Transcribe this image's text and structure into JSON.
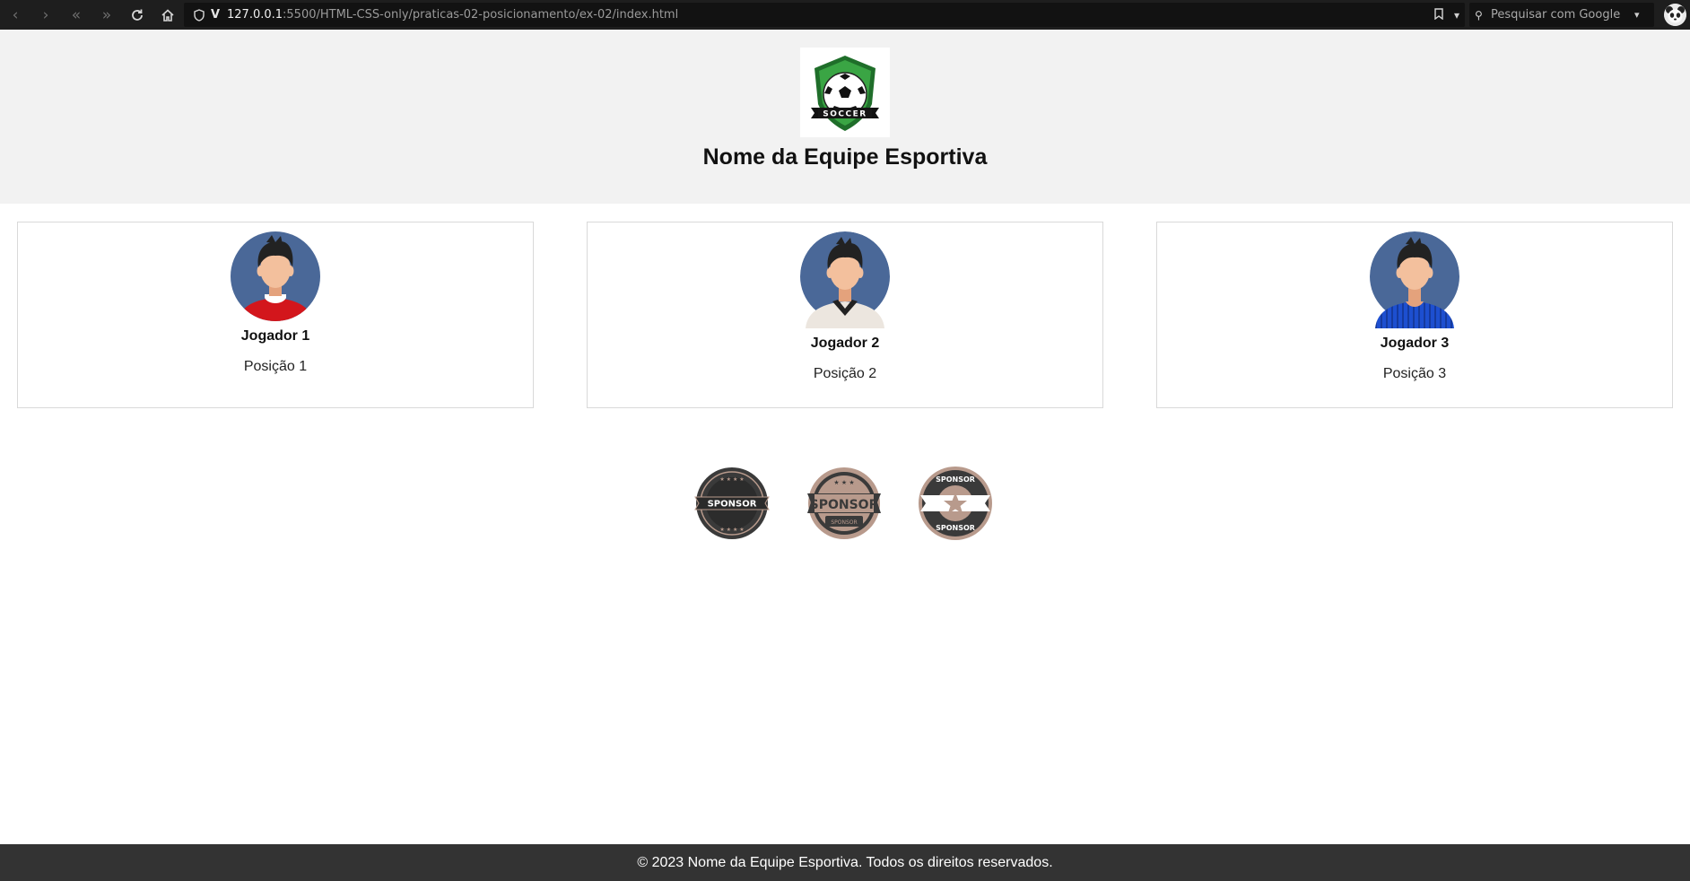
{
  "browser": {
    "url_host": "127.0.0.1",
    "url_rest": ":5500/HTML-CSS-only/praticas-02-posicionamento/ex-02/index.html",
    "search_placeholder": "Pesquisar com Google",
    "nav_icons": [
      "back-icon",
      "forward-icon",
      "rewind-icon",
      "fast-forward-icon",
      "reload-icon",
      "home-icon"
    ]
  },
  "header": {
    "logo_text": "SOCCER",
    "team_name": "Nome da Equipe Esportiva"
  },
  "players": [
    {
      "name": "Jogador 1",
      "position": "Posição 1",
      "shirt_color": "#d3161c"
    },
    {
      "name": "Jogador 2",
      "position": "Posição 2",
      "shirt_color": "#ece6df"
    },
    {
      "name": "Jogador 3",
      "position": "Posição 3",
      "shirt_color": "#1d4fd0"
    }
  ],
  "sponsors": [
    {
      "label": "SPONSOR"
    },
    {
      "label": "SPONSOR",
      "sublabel": "SPONSOR"
    },
    {
      "label": "SPONSOR",
      "sublabel": "SPONSOR"
    }
  ],
  "footer": {
    "text": "© 2023 Nome da Equipe Esportiva. Todos os direitos reservados."
  },
  "colors": {
    "header_bg": "#f2f2f2",
    "footer_bg": "#333333",
    "avatar_bg": "#4a6898",
    "sponsor_dark": "#3a3a3a",
    "sponsor_tan": "#b89a8c"
  }
}
